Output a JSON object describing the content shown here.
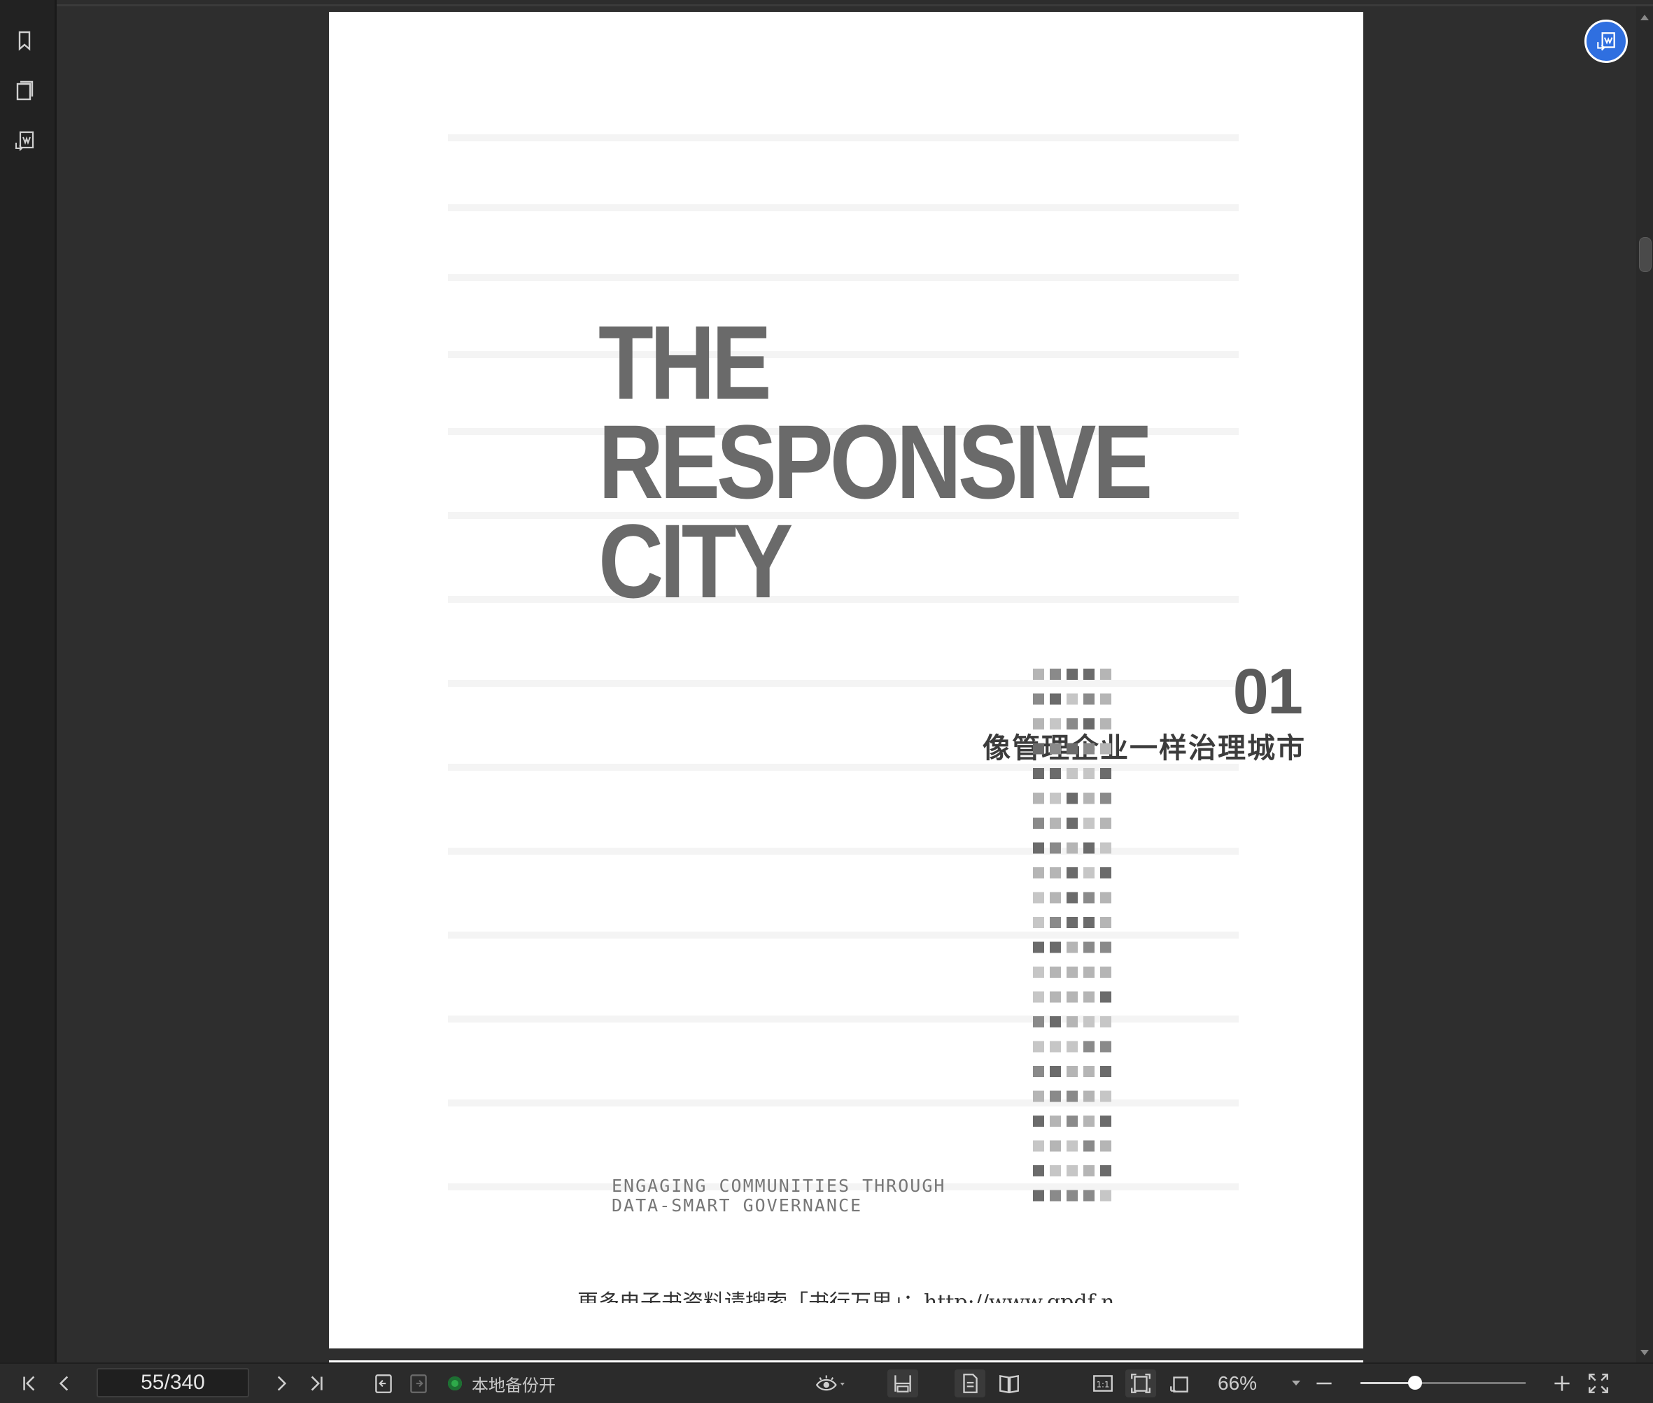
{
  "document": {
    "title_lines": [
      "THE",
      "RESPONSIVE",
      "CITY"
    ],
    "chapter_number": "01",
    "chapter_title": "像管理企业一样治理城市",
    "subtitle_lines": [
      "ENGAGING COMMUNITIES THROUGH",
      "DATA-SMART GOVERNANCE"
    ],
    "footer": "更多电子书资料请搜索「书行万里」：http://www.gpdf.n"
  },
  "sidebar": {
    "icons": [
      "bookmark-icon",
      "page-thumbnails-icon",
      "convert-icon"
    ]
  },
  "toolbar": {
    "page_indicator": "55/340",
    "backup_status": "本地备份开",
    "zoom": "66%",
    "zoom_level": 0.33
  },
  "colors": {
    "accent": "#2f6fe0",
    "status_green": "#2eaa4a",
    "title_gray": "#6a6a6a"
  }
}
